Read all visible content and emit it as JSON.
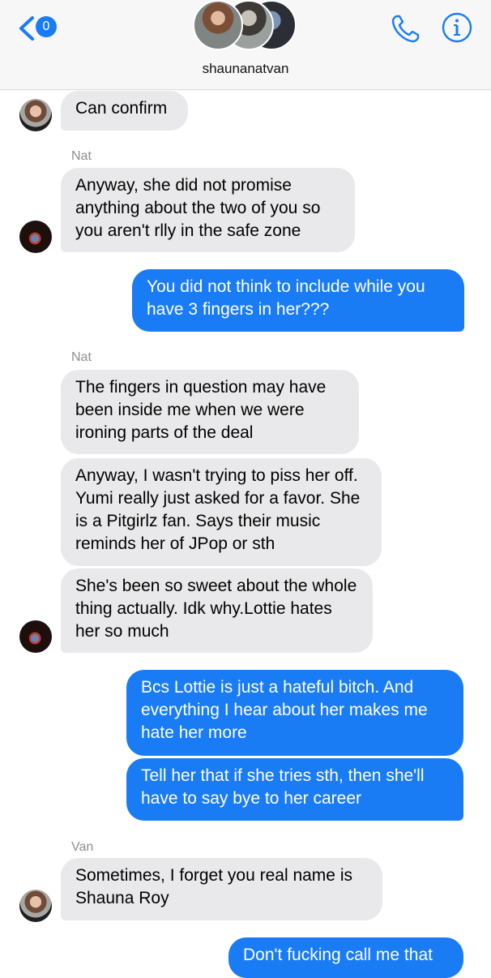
{
  "header": {
    "back_badge": "0",
    "group_name": "shaunanatvan"
  },
  "messages": {
    "m1": "Can confirm",
    "s1": "Nat",
    "m2": "Anyway, she did not promise anything about the two of you so you aren't rlly in the safe zone",
    "m3": "You did not think to include while you have 3 fingers in her???",
    "s2": "Nat",
    "m4": "The fingers in question may have been inside me when we were ironing parts of the deal",
    "m5": "Anyway, I wasn't trying to piss her off. Yumi really just asked for a favor. She is a Pitgirlz fan. Says their music reminds her of JPop or sth",
    "m6": "She's been so sweet about the whole thing actually. Idk why.Lottie hates her so much",
    "m7": "Bcs Lottie is just a hateful bitch. And everything I hear about her makes me hate her more",
    "m8": "Tell her that if she tries sth, then she'll have to say bye to her career",
    "s3": "Van",
    "m9": "Sometimes, I forget you real name is Shauna Roy",
    "m10": "Don't fucking call me that"
  },
  "colors": {
    "accent": "#1a7cf5",
    "incoming_bubble": "#e9e9eb",
    "header_bg": "#f7f7f7"
  },
  "icons": [
    "chevron-left-icon",
    "phone-icon",
    "info-icon"
  ]
}
